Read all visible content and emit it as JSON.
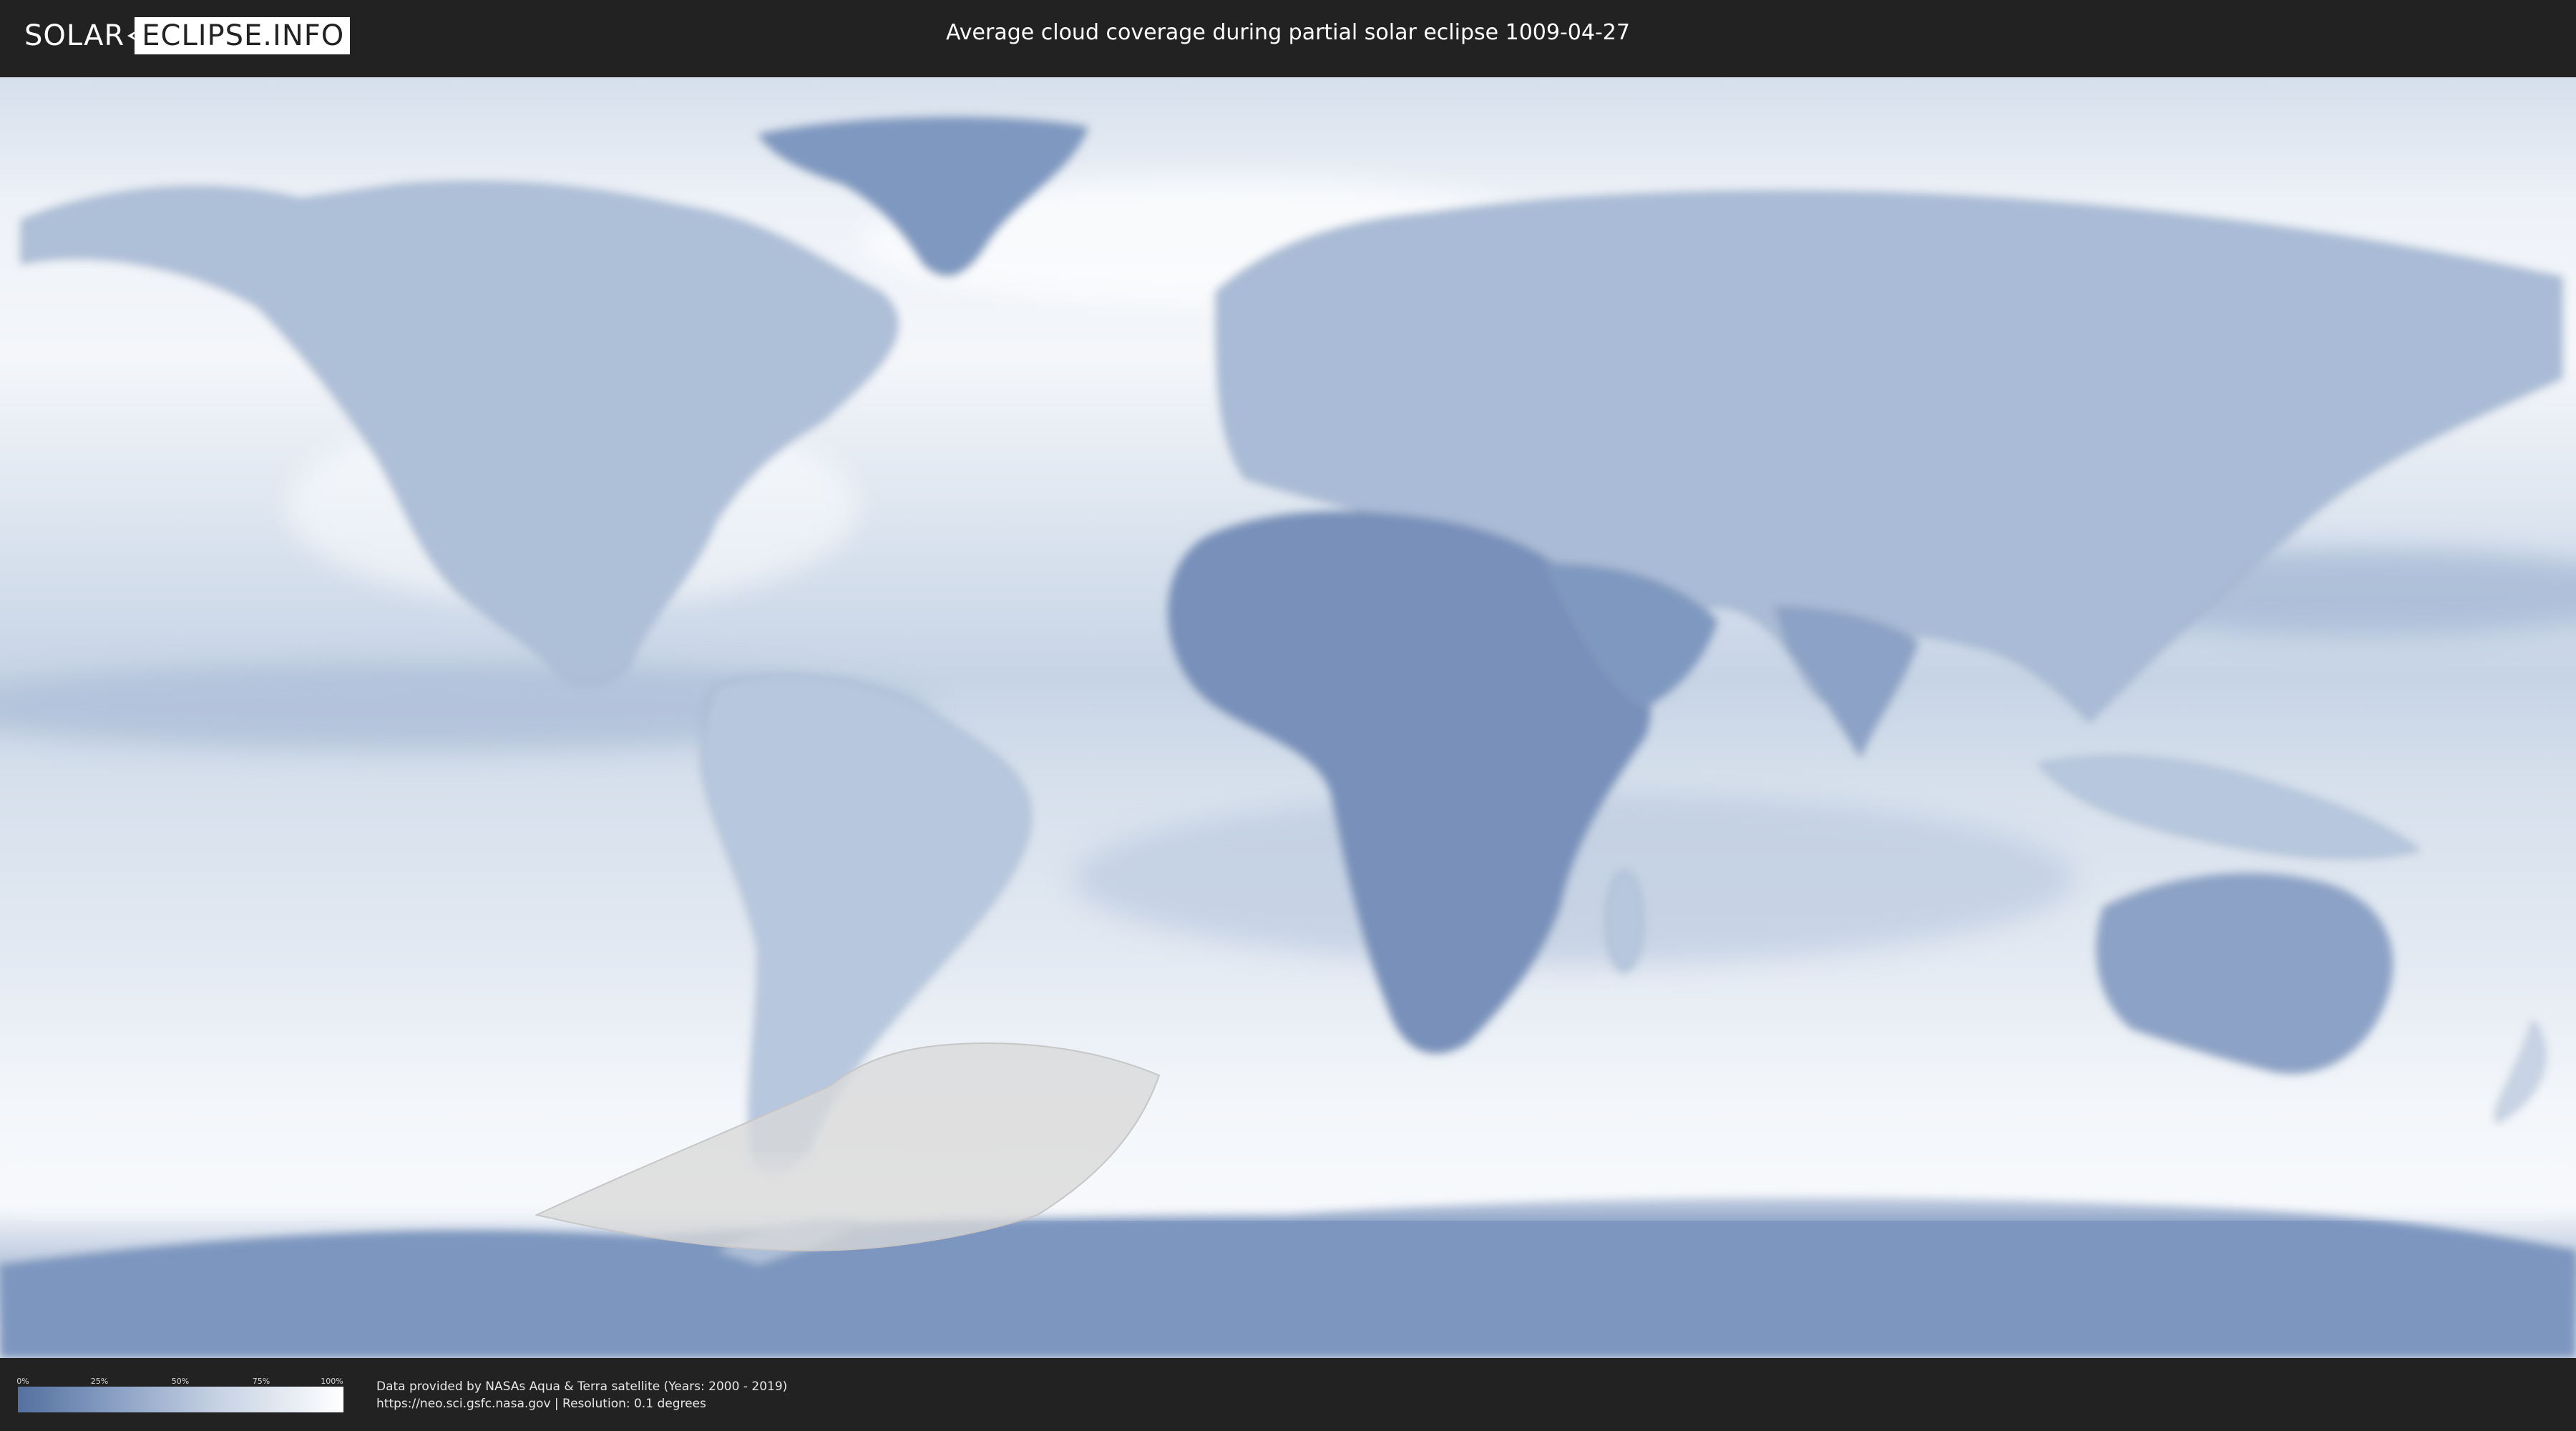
{
  "header": {
    "logo_left": "SOLAR",
    "logo_right": "ECLIPSE.INFO",
    "title": "Average cloud coverage during partial solar eclipse 1009-04-27"
  },
  "legend": {
    "ticks": [
      "0%",
      "25%",
      "50%",
      "75%",
      "100%"
    ],
    "colors": {
      "low": "#5470a0",
      "high": "#ffffff"
    }
  },
  "credits": {
    "line1": "Data provided by NASAs Aqua & Terra satellite (Years: 2000 - 2019)",
    "line2": "https://neo.sci.gsfc.nasa.gov | Resolution: 0.1 degrees"
  },
  "colors": {
    "background": "#222222",
    "ocean_cloudy": "#e6edf5",
    "land_clear": "#6d86b0",
    "eclipse_zone": "#d9d9d9"
  }
}
